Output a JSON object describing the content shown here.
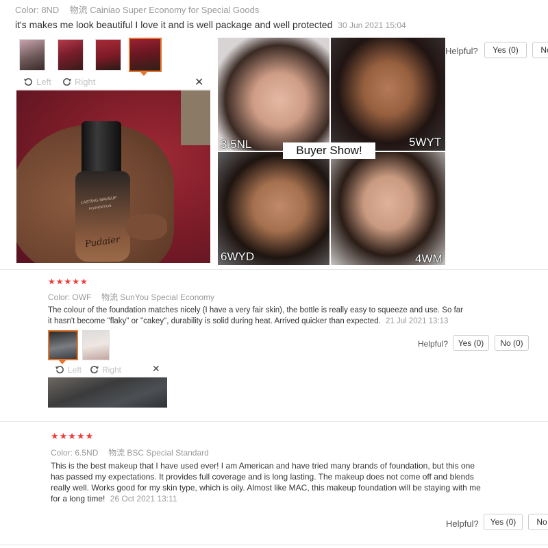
{
  "review1": {
    "color_label": "Color:",
    "color_value": "8ND",
    "ship_label": "物流",
    "ship_value": "Cainiao Super Economy for Special Goods",
    "text": "it's makes me look beautiful I love it and is well package and well protected",
    "date": "30 Jun 2021 15:04",
    "viewer": {
      "left": "Left",
      "right": "Right",
      "close": "✕"
    },
    "product_text_line1": "LASTING MAKEUP",
    "product_text_line2": "FOUNDATION",
    "brand": "Pudaier",
    "buyer_show": {
      "banner": "Buyer Show!",
      "captions": [
        "3.5NL",
        "5WYT",
        "6WYD",
        "4WM"
      ]
    },
    "helpful": "Helpful?",
    "yes": "Yes (0)",
    "no": "No"
  },
  "review2": {
    "stars": "★★★★★",
    "color_label": "Color:",
    "color_value": "OWF",
    "ship_label": "物流",
    "ship_value": "SunYou Special Economy",
    "text_line1": "The colour of the foundation matches nicely (I have a very fair skin), the bottle is really easy to squeeze and use. So far",
    "text_line2": "it hasn't become \"flaky\" or \"cakey\", durability is solid during heat. Arrived quicker than expected.",
    "date": "21 Jul 2021 13:13",
    "viewer": {
      "left": "Left",
      "right": "Right",
      "close": "✕"
    },
    "helpful": "Helpful?",
    "yes": "Yes (0)",
    "no": "No (0)"
  },
  "review3": {
    "stars": "★★★★★",
    "color_label": "Color:",
    "color_value": "6.5ND",
    "ship_label": "物流",
    "ship_value": "BSC Special Standard",
    "text_line1": "This is the best makeup that I have used ever! I am American and have tried many brands of foundation, but this one",
    "text_line2": "has passed my expectations. It provides full coverage and is long lasting. The makeup does not come off and blends",
    "text_line3": "really well. Works good for my skin type, which is oily. Almost like MAC, this makeup foundation will be staying with me",
    "text_line4": "for a long time!",
    "date": "26 Oct 2021 13:11",
    "helpful": "Helpful?",
    "yes": "Yes (0)",
    "no": "No"
  },
  "colors": {
    "accent": "#e8762d",
    "star": "#f03a3a",
    "muted": "#999999",
    "button_border": "#cccccc"
  },
  "icons": [
    "rotate-left-icon",
    "rotate-right-icon",
    "close-icon",
    "star-icon"
  ]
}
